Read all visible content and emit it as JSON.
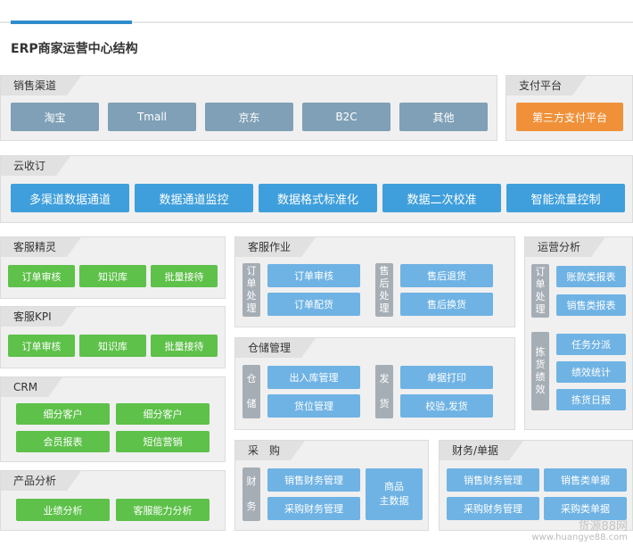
{
  "page": {
    "title": "ERP商家运营中心结构"
  },
  "sales_channels": {
    "label": "销售渠道",
    "items": [
      "淘宝",
      "Tmall",
      "京东",
      "B2C",
      "其他"
    ]
  },
  "payment": {
    "label": "支付平台",
    "item": "第三方支付平台"
  },
  "cloud_order": {
    "label": "云收订",
    "items": [
      "多渠道数据通道",
      "数据通道监控",
      "数据格式标准化",
      "数据二次校准",
      "智能流量控制"
    ]
  },
  "cs_elf": {
    "label": "客服精灵",
    "items": [
      "订单审核",
      "知识库",
      "批量接待"
    ]
  },
  "cs_kpi": {
    "label": "客服KPI",
    "items": [
      "订单审核",
      "知识库",
      "批量接待"
    ]
  },
  "crm": {
    "label": "CRM",
    "items": [
      "细分客户",
      "细分客户",
      "会员报表",
      "短信营销"
    ]
  },
  "product_analysis": {
    "label": "产品分析",
    "items": [
      "业绩分析",
      "客服能力分析"
    ]
  },
  "cs_ops": {
    "label": "客服作业",
    "order_label": "订\n单\n处\n理",
    "order_items": [
      "订单审核",
      "订单配货"
    ],
    "after_label": "售\n后\n处\n理",
    "after_items": [
      "售后退货",
      "售后换货"
    ]
  },
  "warehouse": {
    "label": "仓储管理",
    "store_label": "仓\n\n储",
    "store_items": [
      "出入库管理",
      "货位管理"
    ],
    "ship_label": "发\n\n货",
    "ship_items": [
      "单据打印",
      "校验,发货"
    ]
  },
  "purchase": {
    "label": "采　购",
    "fin_label": "财\n\n务",
    "fin_items": [
      "销售财务管理",
      "采购财务管理"
    ],
    "product_master": "商品\n主数据"
  },
  "finance": {
    "label": "财务/单据",
    "items": [
      "销售财务管理",
      "销售类单据",
      "采购财务管理",
      "采购类单据"
    ]
  },
  "ops_analysis": {
    "label": "运营分析",
    "order_label": "订\n单\n处\n理",
    "order_items": [
      "账款类报表",
      "销售类报表"
    ],
    "pick_label": "拣\n货\n绩\n效",
    "pick_items": [
      "任务分派",
      "绩效统计",
      "拣货日报"
    ]
  },
  "watermark": {
    "line1": "货源88网",
    "line2": "www.huangye88.com"
  },
  "colors": {
    "accent": "#2f8ccd",
    "gray_button": "#7fa0b6",
    "blue_button": "#3f9fdc",
    "light_blue": "#6fb3e4",
    "green": "#5ec14a",
    "orange": "#f0913a"
  }
}
